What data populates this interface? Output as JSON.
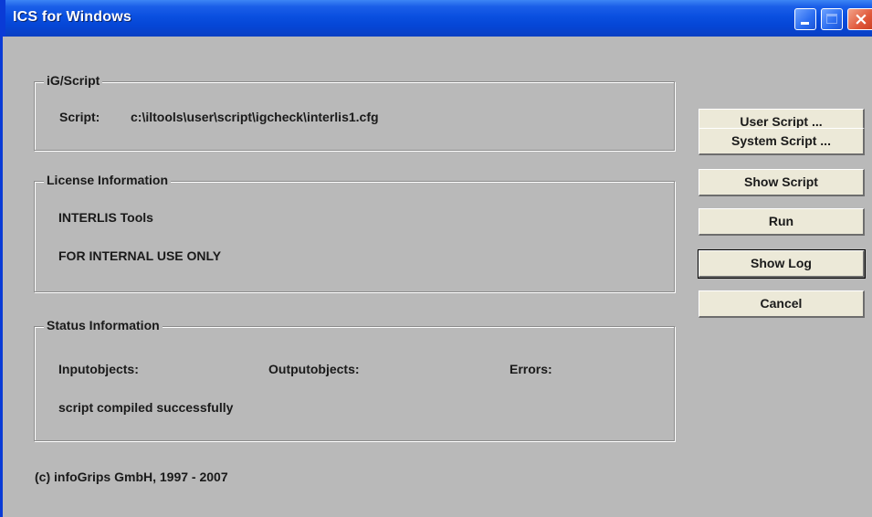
{
  "window": {
    "title": "ICS for Windows"
  },
  "title_buttons": {
    "minimize_icon": "minimize-icon",
    "maximize_icon": "maximize-icon",
    "close_icon": "close-icon",
    "close_glyph": "×"
  },
  "script_group": {
    "title": "iG/Script",
    "script_label": "Script:",
    "script_path": "c:\\iltools\\user\\script\\igcheck\\interlis1.cfg"
  },
  "license_group": {
    "title": "License Information",
    "product": "INTERLIS Tools",
    "usage": "FOR INTERNAL USE ONLY"
  },
  "status_group": {
    "title": "Status Information",
    "input_label": "Inputobjects:",
    "output_label": "Outputobjects:",
    "errors_label": "Errors:",
    "message": "script compiled successfully"
  },
  "buttons": {
    "user_script": "User Script ...",
    "system_script": "System Script ...",
    "show_script": "Show Script",
    "run": "Run",
    "show_log": "Show Log",
    "cancel": "Cancel"
  },
  "footer": {
    "copyright": "(c) infoGrips GmbH, 1997 - 2007"
  },
  "colors": {
    "titlebar": "#0546d6",
    "window_bg": "#b9b9b9",
    "button_bg": "#ece9d8",
    "close_button": "#e0583a"
  }
}
